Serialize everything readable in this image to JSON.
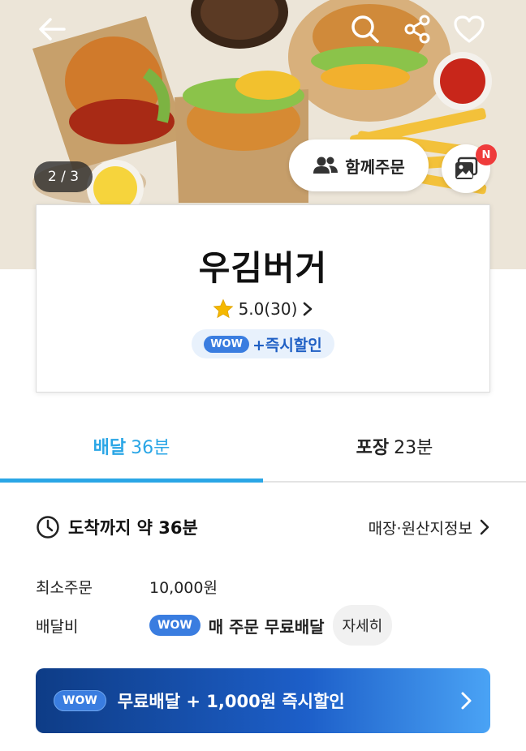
{
  "header": {
    "back_icon": "arrow-left-icon",
    "search_icon": "search-icon",
    "share_icon": "share-icon",
    "favorite_icon": "heart-icon",
    "page_counter": "2 / 3",
    "group_order_label": "함께주문",
    "photo_badge": "N"
  },
  "store": {
    "name": "우김버거",
    "rating": "5.0(30)",
    "wow_badge": "WOW",
    "wow_promo": "+즉시할인"
  },
  "tabs": [
    {
      "label": "배달",
      "time": "36분",
      "active": true
    },
    {
      "label": "포장",
      "time": "23분",
      "active": false
    }
  ],
  "info": {
    "eta": "도착까지 약 36분",
    "origin_link": "매장·원산지정보",
    "min_order_label": "최소주문",
    "min_order_value": "10,000원",
    "delivery_fee_label": "배달비",
    "wow_badge": "WOW",
    "delivery_fee_value": "매 주문 무료배달",
    "detail_button": "자세히"
  },
  "banner": {
    "wow_badge": "WOW",
    "text": "무료배달 + 1,000원 즉시할인"
  },
  "colors": {
    "accent": "#2aa6e6",
    "wow_blue": "#3a7de0",
    "badge_red": "#ef3b3b"
  }
}
